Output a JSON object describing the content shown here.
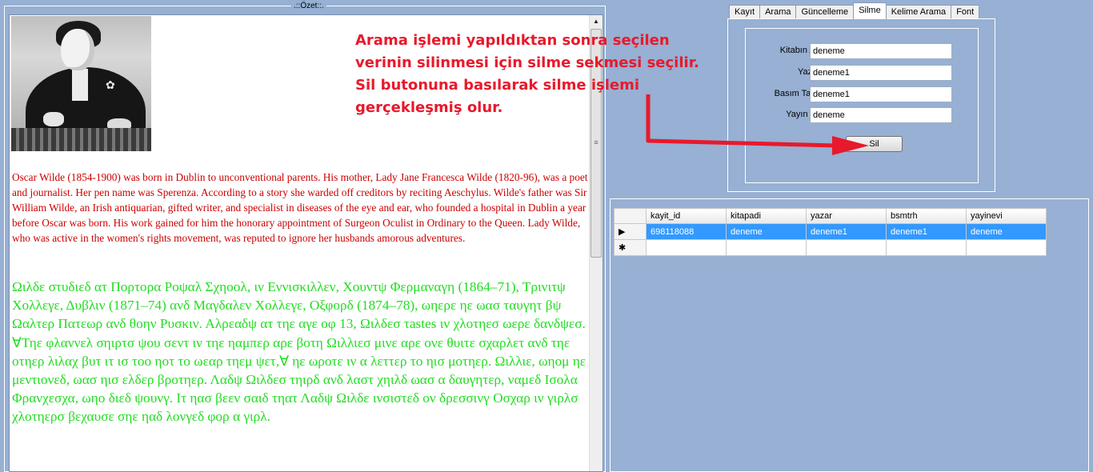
{
  "ozet": {
    "title": ".::Özet::.",
    "bio_red": "Oscar Wilde (1854-1900) was born in Dublin to unconventional parents. His mother, Lady Jane Francesca Wilde (1820-96), was a poet and journalist. Her pen name was Sperenza. According to a story she warded off creditors by reciting Aeschylus. Wilde's father was Sir William Wilde, an Irish antiquarian, gifted writer, and specialist in diseases of the eye and ear, who founded a hospital in Dublin a year before Oscar was born. His work gained for him the honorary appointment of Surgeon Oculist in Ordinary to the Queen. Lady Wilde, who was active in the women's rights movement, was reputed to ignore her husbands amorous adventures.",
    "bio_green": "Ωιλδε στυδιεδ ατ Πορτορα Ροψαλ Σχηοολ, ιν Εννισκιλλεν, Χουντψ Φερμαναγη (1864–71), Τρινιτψ Χολλεγε, Δυβλιν (1871–74) ανδ Μαγδαλεν Χολλεγε, Οξφορδ (1874–78), ωηερε ηε ωασ ταυγητ βψ Ωαλτερ Πατεωρ ανδ θοην Ρυσκιν. Αλρεαδψ ατ τηε αγε οφ 13, Ωιλδεσ τastes ιν χλοτηεσ ωερε δανδψεσ. ∀Τηε φλαννελ σηιρτσ ψου σεντ ιν τηε ηαμπερ αρε βοτη Ωιλλιεσ μινε αρε ονε θυιτε σχαρλετ ανδ τηε οτηερ λιλαχ βυτ ιτ ισ τοο ηοτ το ωεαρ τηεμ ψετ,∀ ηε ωροτε ιν α λεττερ το ηισ μοτηερ. Ωιλλιε, ωηομ ηε μεντιονεδ, ωασ ηισ ελδερ βροτηερ. Λαδψ Ωιλδεσ τηιρδ ανδ λαστ χηιλδ ωασ α δαυγητερ, ναμεδ Ισολα Φρανχεσχα, ωηο διεδ ψουνγ. Ιτ ηασ βεεν σαιδ τηατ Λαδψ Ωιλδε ινσιστεδ ον δρεσσινγ Οσχαρ ιν γιρλσ χλοτηερσ βεχαυσε σηε ηαδ λονγεδ φορ α γιρλ."
  },
  "annotation": {
    "line1": "Arama işlemi yapıldıktan sonra seçilen",
    "line2": "verinin silinmesi için silme sekmesi seçilir.",
    "line3": "Sil butonuna basılarak silme işlemi",
    "line4": "gerçekleşmiş olur."
  },
  "tabs": [
    "Kayıt",
    "Arama",
    "Güncelleme",
    "Silme",
    "Kelime Arama",
    "Font"
  ],
  "active_tab": "Silme",
  "form": {
    "kitap_label": "Kitabın Adı:",
    "kitap_value": "deneme",
    "yazar_label": "Yazarı:",
    "yazar_value": "deneme1",
    "basim_label": "Basım Tarihi:",
    "basim_value": "deneme1",
    "yayin_label": "Yayın Evi:",
    "yayin_value": "deneme",
    "sil_button": "Sil"
  },
  "grid": {
    "columns": [
      "kayit_id",
      "kitapadi",
      "yazar",
      "bsmtrh",
      "yayinevi"
    ],
    "rows": [
      [
        "698118088",
        "deneme",
        "deneme1",
        "deneme1",
        "deneme"
      ]
    ],
    "selected_indicator": "▶",
    "new_row_indicator": "✱"
  },
  "colors": {
    "background": "#97b0d3",
    "annotation": "#e8192c",
    "bio_red": "#cc0000",
    "bio_green": "#22dd22",
    "selection": "#3399ff"
  }
}
